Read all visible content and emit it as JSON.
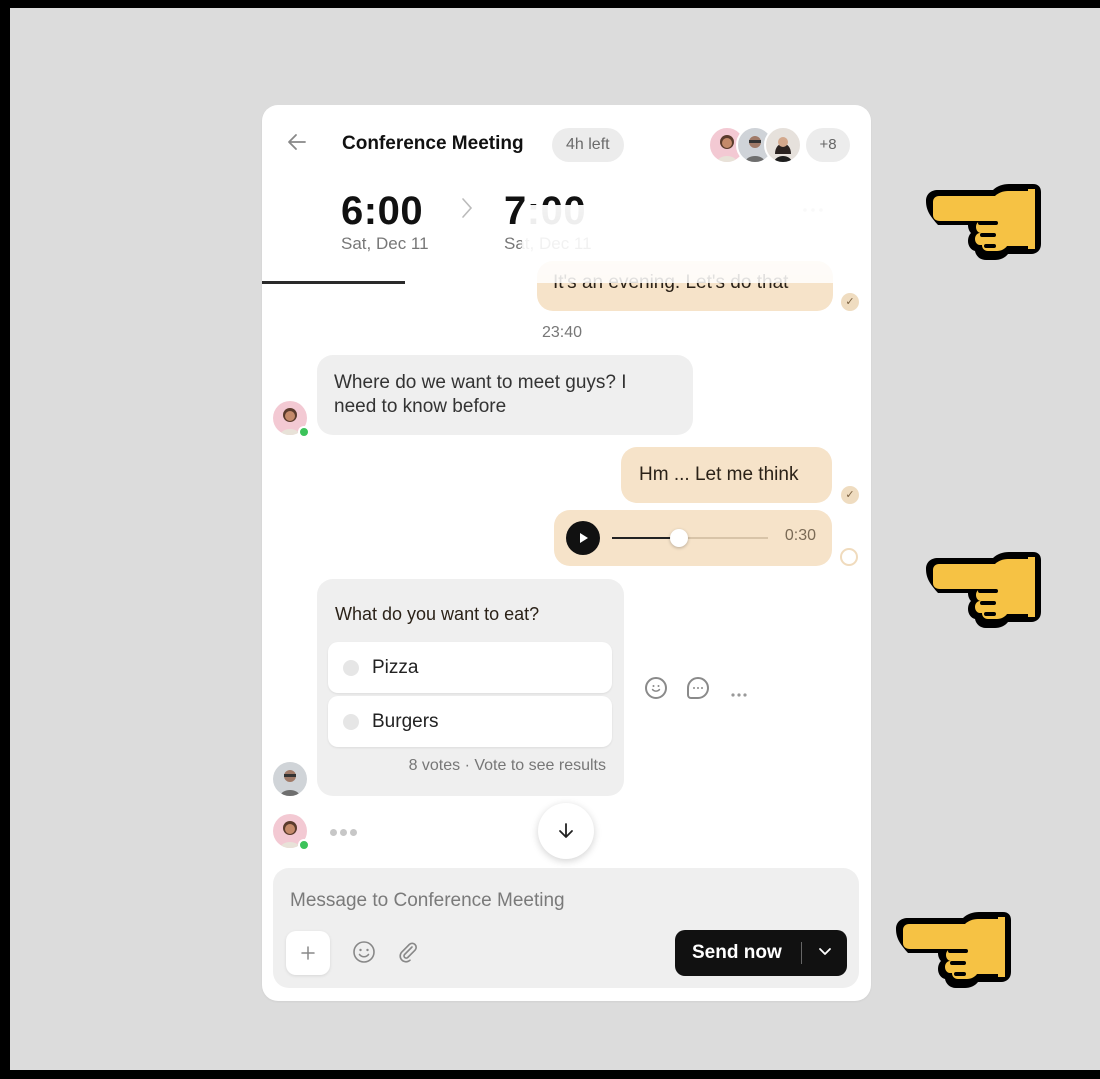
{
  "header": {
    "title": "Conference Meeting",
    "badge": "4h left",
    "participants_more": "+8",
    "start_time": "6:00",
    "start_date": "Sat, Dec 11",
    "end_time": "7:00",
    "end_date": "Sat, Dec 11",
    "menu_icon": "more-horizontal-icon",
    "back_icon": "arrow-left-icon"
  },
  "messages": {
    "out_1_partial": "It's an evening. Let's do that",
    "timestamp": "23:40",
    "in_1": "Where do we want to meet guys? I need to know before",
    "out_2": "Hm ... Let me think",
    "voice_duration": "0:30",
    "voice_progress": 0.43
  },
  "poll": {
    "question": "What do you want to eat?",
    "options": [
      {
        "label": "Pizza"
      },
      {
        "label": "Burgers"
      }
    ],
    "footer": "8 votes · Vote to see results"
  },
  "composer": {
    "placeholder": "Message to Conference Meeting",
    "send_label": "Send now"
  },
  "colors": {
    "outgoing_bubble": "#f6e3c9",
    "incoming_bubble": "#efefef",
    "send_button": "#111111",
    "online_dot": "#3cc35a",
    "pointer_hand": "#f6c244"
  }
}
